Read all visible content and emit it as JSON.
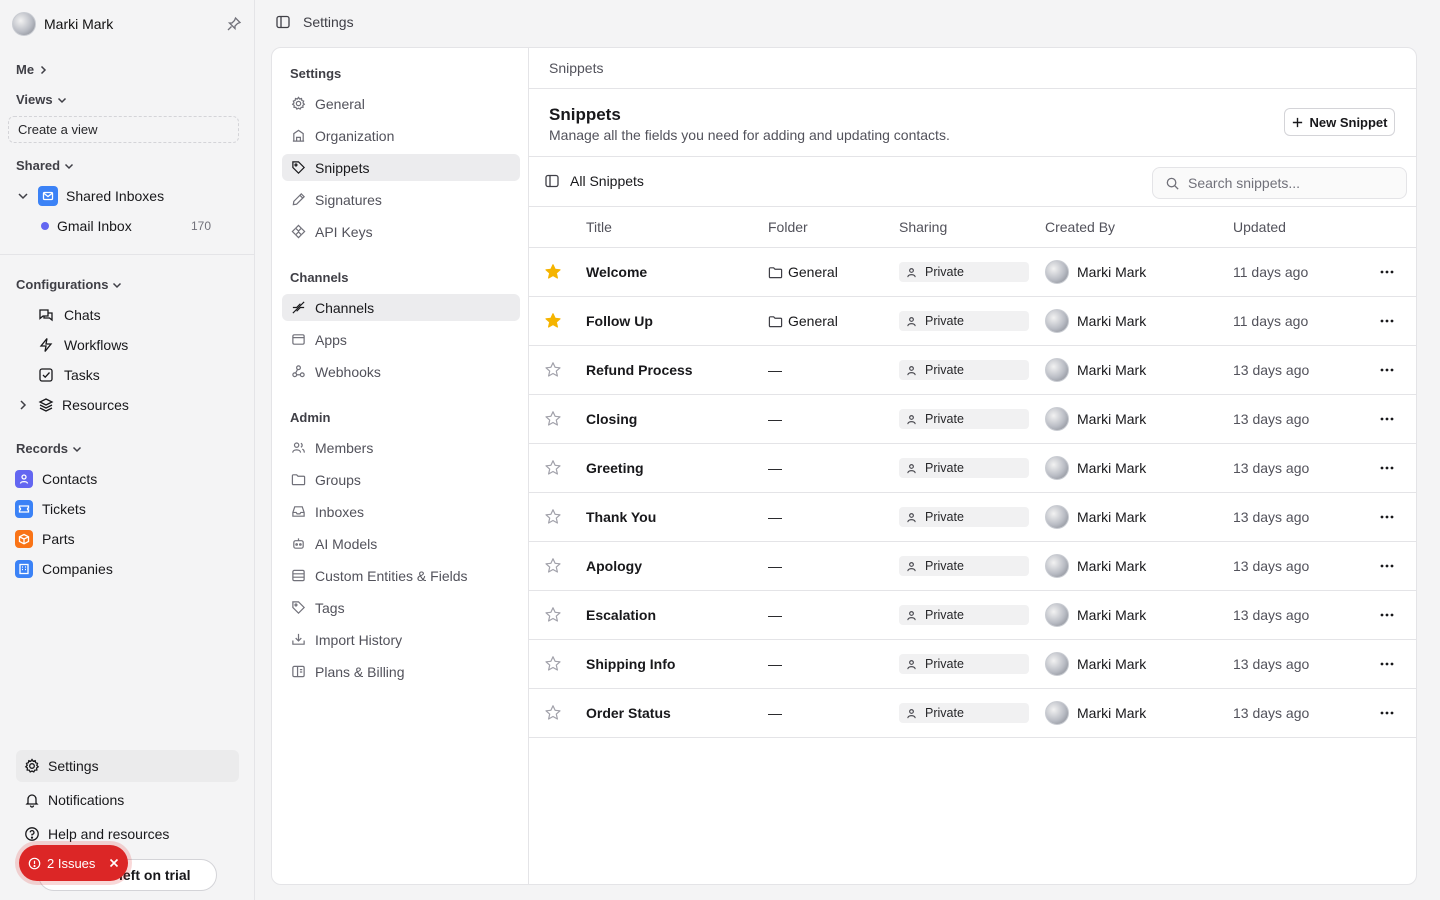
{
  "user": {
    "name": "Marki Mark"
  },
  "sidebar": {
    "me_label": "Me",
    "views_label": "Views",
    "create_view": "Create a view",
    "shared_label": "Shared",
    "shared_inboxes": "Shared Inboxes",
    "gmail_inbox": "Gmail Inbox",
    "gmail_count": "170",
    "configurations_label": "Configurations",
    "config_items": [
      "Chats",
      "Workflows",
      "Tasks",
      "Resources"
    ],
    "records_label": "Records",
    "records": [
      {
        "label": "Contacts",
        "color": "#6366f1"
      },
      {
        "label": "Tickets",
        "color": "#3b82f6"
      },
      {
        "label": "Parts",
        "color": "#f97316"
      },
      {
        "label": "Companies",
        "color": "#3b82f6"
      }
    ],
    "bottom": [
      "Settings",
      "Notifications",
      "Help and resources"
    ],
    "trial_text": "left on trial",
    "issues_text": "2 Issues"
  },
  "header": {
    "title": "Settings"
  },
  "settings_nav": {
    "settings_head": "Settings",
    "settings_items": [
      "General",
      "Organization",
      "Snippets",
      "Signatures",
      "API Keys"
    ],
    "channels_head": "Channels",
    "channels_items": [
      "Channels",
      "Apps",
      "Webhooks"
    ],
    "admin_head": "Admin",
    "admin_items": [
      "Members",
      "Groups",
      "Inboxes",
      "AI Models",
      "Custom Entities & Fields",
      "Tags",
      "Import History",
      "Plans & Billing"
    ]
  },
  "content": {
    "breadcrumb": "Snippets",
    "title": "Snippets",
    "subtitle": "Manage all the fields you need for adding and updating contacts.",
    "new_button": "New Snippet",
    "all_snippets": "All Snippets",
    "search_placeholder": "Search snippets...",
    "columns": [
      "Title",
      "Folder",
      "Sharing",
      "Created By",
      "Updated"
    ],
    "rows": [
      {
        "title": "Welcome",
        "starred": true,
        "folder": "General",
        "sharing": "Private",
        "created_by": "Marki Mark",
        "updated": "11 days ago"
      },
      {
        "title": "Follow Up",
        "starred": true,
        "folder": "General",
        "sharing": "Private",
        "created_by": "Marki Mark",
        "updated": "11 days ago"
      },
      {
        "title": "Refund Process",
        "starred": false,
        "folder": "—",
        "sharing": "Private",
        "created_by": "Marki Mark",
        "updated": "13 days ago"
      },
      {
        "title": "Closing",
        "starred": false,
        "folder": "—",
        "sharing": "Private",
        "created_by": "Marki Mark",
        "updated": "13 days ago"
      },
      {
        "title": "Greeting",
        "starred": false,
        "folder": "—",
        "sharing": "Private",
        "created_by": "Marki Mark",
        "updated": "13 days ago"
      },
      {
        "title": "Thank You",
        "starred": false,
        "folder": "—",
        "sharing": "Private",
        "created_by": "Marki Mark",
        "updated": "13 days ago"
      },
      {
        "title": "Apology",
        "starred": false,
        "folder": "—",
        "sharing": "Private",
        "created_by": "Marki Mark",
        "updated": "13 days ago"
      },
      {
        "title": "Escalation",
        "starred": false,
        "folder": "—",
        "sharing": "Private",
        "created_by": "Marki Mark",
        "updated": "13 days ago"
      },
      {
        "title": "Shipping Info",
        "starred": false,
        "folder": "—",
        "sharing": "Private",
        "created_by": "Marki Mark",
        "updated": "13 days ago"
      },
      {
        "title": "Order Status",
        "starred": false,
        "folder": "—",
        "sharing": "Private",
        "created_by": "Marki Mark",
        "updated": "13 days ago"
      }
    ]
  },
  "colors": {
    "star": "#f5b400",
    "issues": "#dc2626",
    "gmail_dot": "#6366f1",
    "inbox_icon": "#3b82f6"
  }
}
